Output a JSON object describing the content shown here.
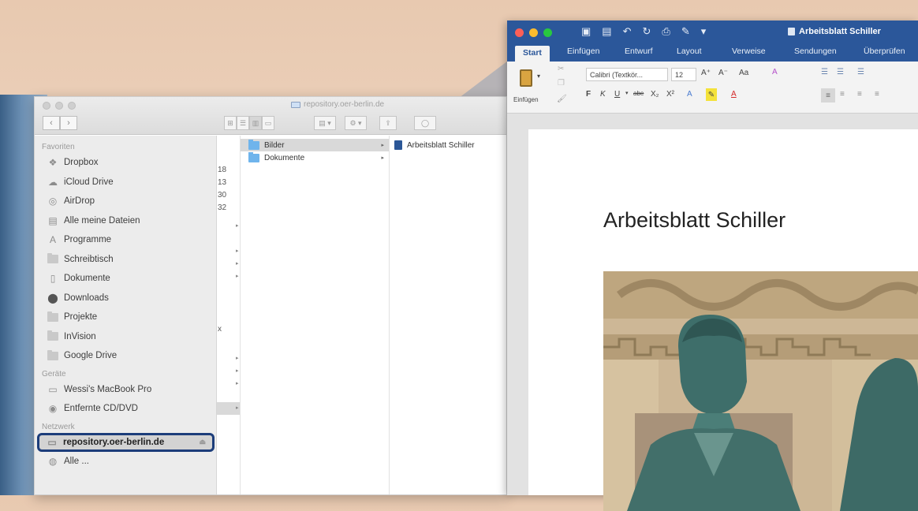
{
  "finder": {
    "title": "repository.oer-berlin.de",
    "nav": {
      "back": "‹",
      "forward": "›"
    },
    "sidebar": {
      "favorites_header": "Favoriten",
      "favorites": [
        {
          "label": "Dropbox",
          "icon": "dropbox-icon"
        },
        {
          "label": "iCloud Drive",
          "icon": "cloud-icon"
        },
        {
          "label": "AirDrop",
          "icon": "airdrop-icon"
        },
        {
          "label": "Alle meine Dateien",
          "icon": "all-files-icon"
        },
        {
          "label": "Programme",
          "icon": "applications-icon"
        },
        {
          "label": "Schreibtisch",
          "icon": "desktop-folder-icon"
        },
        {
          "label": "Dokumente",
          "icon": "documents-icon"
        },
        {
          "label": "Downloads",
          "icon": "downloads-icon"
        },
        {
          "label": "Projekte",
          "icon": "folder-icon"
        },
        {
          "label": "InVision",
          "icon": "folder-icon"
        },
        {
          "label": "Google Drive",
          "icon": "folder-icon"
        }
      ],
      "devices_header": "Geräte",
      "devices": [
        {
          "label": "Wessi's MacBook Pro",
          "icon": "laptop-icon"
        },
        {
          "label": "Entfernte CD/DVD",
          "icon": "disc-icon"
        }
      ],
      "network_header": "Netzwerk",
      "network": [
        {
          "label": "repository.oer-berlin.de",
          "icon": "server-icon",
          "selected": true
        },
        {
          "label": "Alle ...",
          "icon": "network-icon"
        }
      ]
    },
    "column0_fragments": [
      "18",
      "13",
      "30",
      "32",
      "x"
    ],
    "column1": [
      {
        "label": "Bilder",
        "selected": true
      },
      {
        "label": "Dokumente",
        "selected": false
      }
    ],
    "column2": [
      {
        "label": "Arbeitsblatt Schiller"
      }
    ]
  },
  "word": {
    "title": "Arbeitsblatt Schiller",
    "tabs": [
      "Start",
      "Einfügen",
      "Entwurf",
      "Layout",
      "Verweise",
      "Sendungen",
      "Überprüfen"
    ],
    "ribbon": {
      "paste_label": "Einfügen",
      "font_name": "Calibri (Textkör...",
      "font_size": "12",
      "bold": "F",
      "italic": "K",
      "underline": "U",
      "strike": "abe",
      "subscript": "X₂",
      "superscript": "X²"
    },
    "document_heading": "Arbeitsblatt Schiller"
  },
  "colors": {
    "word_blue": "#2b579a",
    "selection_outline": "#1c3d7a",
    "folder_blue": "#6fb4ec"
  }
}
